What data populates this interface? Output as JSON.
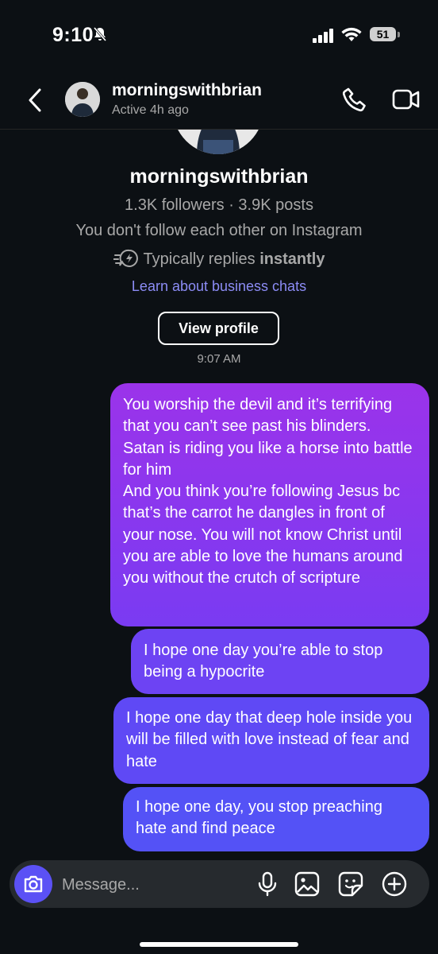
{
  "status_bar": {
    "time": "9:10",
    "battery": "51"
  },
  "header": {
    "username": "morningswithbrian",
    "activity": "Active 4h ago"
  },
  "profile": {
    "username": "morningswithbrian",
    "stats": "1.3K followers · 3.9K posts",
    "follow_status": "You don't follow each other on Instagram",
    "replies_prefix": "Typically replies ",
    "replies_speed": "instantly",
    "learn_link": "Learn about business chats",
    "view_profile": "View profile"
  },
  "timestamp": "9:07 AM",
  "messages": [
    {
      "paragraphs": [
        "You worship the devil and it’s terrifying that you can’t see past his blinders. Satan is riding you like a horse into battle for him",
        "And you think you’re following Jesus bc that’s the carrot he dangles in front of your nose. You will not know Christ until you are able to love the humans around you without the crutch of scripture"
      ]
    },
    {
      "text": "I hope one day you’re able to stop being a hypocrite"
    },
    {
      "text": "I hope one day that deep hole inside you will be filled with love instead of fear and hate"
    },
    {
      "text": "I hope one day, you stop preaching hate and find peace"
    }
  ],
  "composer": {
    "placeholder": "Message..."
  },
  "colors": {
    "background": "#0c1014",
    "accent": "#5b51f5",
    "bubble_top": "#9b33ea",
    "bubble_bottom": "#5452f6",
    "link": "#8c8cf5"
  }
}
